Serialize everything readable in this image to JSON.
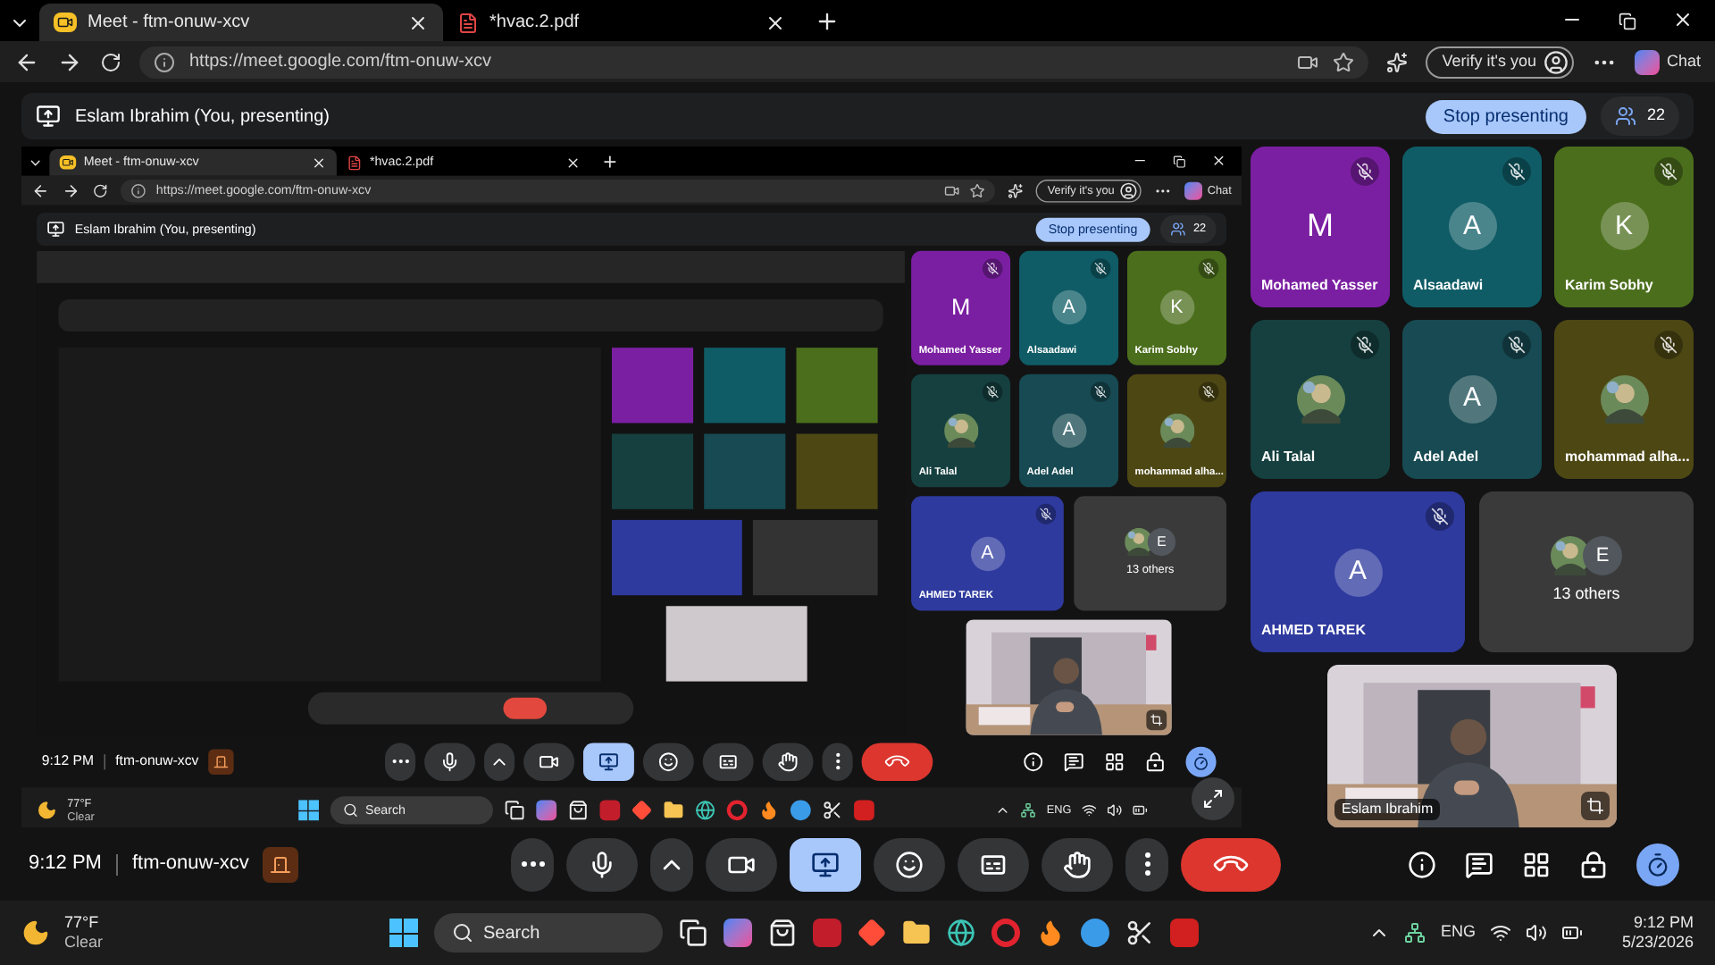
{
  "browser": {
    "tabs": [
      {
        "title": "Meet - ftm-onuw-xcv",
        "kind": "meet",
        "selected": true
      },
      {
        "title": "*hvac.2.pdf",
        "kind": "pdf",
        "selected": false
      }
    ],
    "url": "https://meet.google.com/ftm-onuw-xcv",
    "verify": "Verify it's you",
    "chat": "Chat"
  },
  "meeting_header": {
    "presenter": "Eslam Ibrahim (You, presenting)",
    "stop_button": "Stop presenting",
    "people_count": "22"
  },
  "tiles": [
    {
      "name": "Mohamed Yasser",
      "initial": "M",
      "kind": "letter",
      "color": "#7b1fa2",
      "muted": true
    },
    {
      "name": "Alsaadawi",
      "initial": "A",
      "kind": "avatar",
      "color": "#0f5c66",
      "muted": true
    },
    {
      "name": "Karim Sobhy",
      "initial": "K",
      "kind": "avatar",
      "color": "#4b6e1c",
      "muted": true
    },
    {
      "name": "Ali Talal",
      "color": "#15403f",
      "muted": true
    },
    {
      "name": "Adel Adel",
      "initial": "A",
      "kind": "avatar",
      "color": "#174a52",
      "muted": true
    },
    {
      "name": "mohammad alha...",
      "color": "#4d4714",
      "muted": true
    },
    {
      "name": "AHMED TAREK",
      "initial": "A",
      "kind": "avatar",
      "color": "#2e3a9e",
      "muted": true
    }
  ],
  "others": {
    "label": "13 others",
    "initial": "E"
  },
  "self_view": {
    "name": "Eslam Ibrahim"
  },
  "controls": {
    "time": "9:12 PM",
    "code": "ftm-onuw-xcv",
    "buttons": [
      {
        "kind": "more",
        "selected": false
      },
      {
        "kind": "mic",
        "selected": false
      },
      {
        "kind": "chevron",
        "selected": false
      },
      {
        "kind": "camera",
        "selected": false
      },
      {
        "kind": "present",
        "selected": true
      },
      {
        "kind": "emoji",
        "selected": false
      },
      {
        "kind": "captions",
        "selected": false
      },
      {
        "kind": "hand",
        "selected": false
      },
      {
        "kind": "menu",
        "selected": false
      },
      {
        "kind": "leave",
        "selected": false
      }
    ]
  },
  "taskbar": {
    "temperature": "77°F",
    "weather": "Clear",
    "search": "Search",
    "language": "ENG",
    "time": "9:12 PM",
    "date": "5/23/2026"
  },
  "screen_share": {
    "browser": {
      "tabs": [
        {
          "title": "Meet - ftm-onuw-xcv",
          "kind": "meet",
          "selected": true
        },
        {
          "title": "*hvac.2.pdf",
          "kind": "pdf",
          "selected": false
        }
      ],
      "url": "https://meet.google.com/ftm-onuw-xcv",
      "verify": "Verify it's you",
      "chat": "Chat"
    },
    "meeting_header": {
      "presenter": "Eslam Ibrahim (You, presenting)",
      "stop_button": "Stop presenting",
      "people_count": "22"
    },
    "tiles": [
      {
        "name": "Mohamed Yasser",
        "initial": "M",
        "kind": "letter",
        "color": "#7b1fa2",
        "muted": true
      },
      {
        "name": "Alsaadawi",
        "initial": "A",
        "kind": "avatar",
        "color": "#0f5c66",
        "muted": true
      },
      {
        "name": "Karim Sobhy",
        "initial": "K",
        "kind": "avatar",
        "color": "#4b6e1c",
        "muted": true
      },
      {
        "name": "Ali Talal",
        "color": "#15403f",
        "muted": true
      },
      {
        "name": "Adel Adel",
        "initial": "A",
        "kind": "avatar",
        "color": "#174a52",
        "muted": true
      },
      {
        "name": "mohammad alha...",
        "color": "#4d4714",
        "muted": true
      },
      {
        "name": "AHMED TAREK",
        "initial": "A",
        "kind": "avatar",
        "color": "#2e3a9e",
        "muted": true
      }
    ],
    "others": {
      "label": "13 others",
      "initial": "E"
    },
    "controls": {
      "time": "9:12 PM",
      "code": "ftm-onuw-xcv",
      "buttons": [
        {
          "kind": "more",
          "selected": false
        },
        {
          "kind": "mic",
          "selected": false
        },
        {
          "kind": "chevron",
          "selected": false
        },
        {
          "kind": "camera",
          "selected": false
        },
        {
          "kind": "present",
          "selected": true
        },
        {
          "kind": "emoji",
          "selected": false
        },
        {
          "kind": "captions",
          "selected": false
        },
        {
          "kind": "hand",
          "selected": false
        },
        {
          "kind": "menu",
          "selected": false
        },
        {
          "kind": "leave",
          "selected": false
        }
      ]
    },
    "taskbar": {
      "temperature": "77°F",
      "weather": "Clear",
      "search": "Search",
      "language": "ENG"
    }
  }
}
